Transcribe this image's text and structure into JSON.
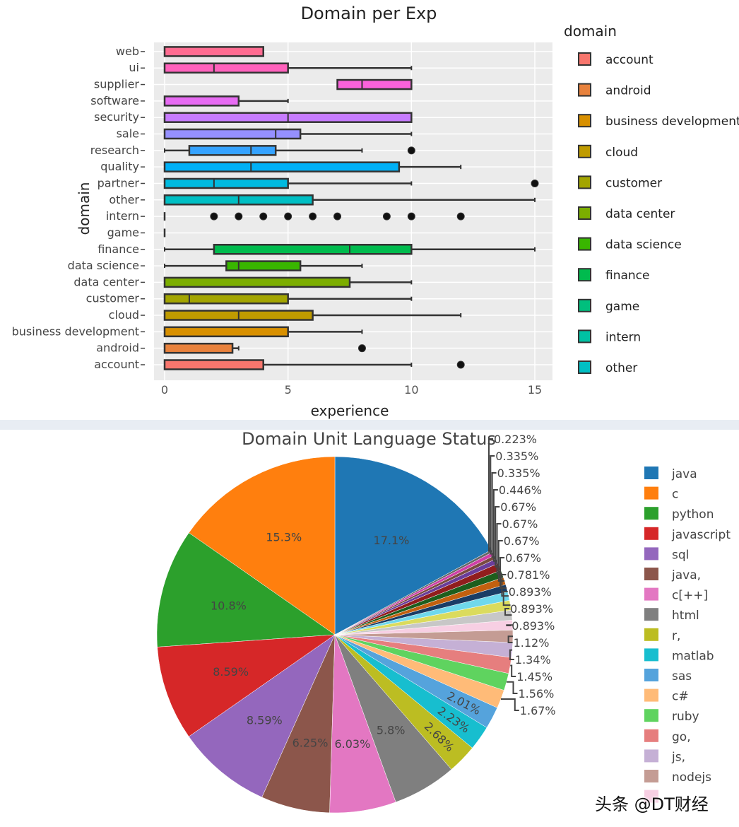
{
  "chart_data": [
    {
      "type": "box",
      "title": "Domain per Exp",
      "xlabel": "experience",
      "ylabel": "domain",
      "xlim": [
        -0.5,
        15.7
      ],
      "xticks": [
        0,
        5,
        10,
        15
      ],
      "grid": true,
      "legend_title": "domain",
      "legend_position": "right",
      "categories": [
        "account",
        "android",
        "business development",
        "cloud",
        "customer",
        "data center",
        "data science",
        "finance",
        "game",
        "intern",
        "other",
        "partner",
        "quality",
        "research",
        "sale",
        "security",
        "software",
        "supplier",
        "ui",
        "web"
      ],
      "series": [
        {
          "name": "account",
          "min": 0,
          "q1": 0,
          "median": 0,
          "q3": 4,
          "max": 10,
          "outliers": [
            12
          ],
          "color": "#F8766D"
        },
        {
          "name": "android",
          "min": 0,
          "q1": 0,
          "median": 0,
          "q3": 2.75,
          "max": 3,
          "outliers": [
            8
          ],
          "color": "#E8823D"
        },
        {
          "name": "business development",
          "min": 0,
          "q1": 0,
          "median": 0,
          "q3": 5,
          "max": 8,
          "outliers": [],
          "color": "#D89000"
        },
        {
          "name": "cloud",
          "min": 0,
          "q1": 0,
          "median": 3,
          "q3": 6,
          "max": 12,
          "outliers": [],
          "color": "#BF9B00"
        },
        {
          "name": "customer",
          "min": 0,
          "q1": 0,
          "median": 1,
          "q3": 5,
          "max": 10,
          "outliers": [],
          "color": "#A3A500"
        },
        {
          "name": "data center",
          "min": 0,
          "q1": 0,
          "median": 0,
          "q3": 7.5,
          "max": 10,
          "outliers": [],
          "color": "#7CAE00"
        },
        {
          "name": "data science",
          "min": 0,
          "q1": 2.5,
          "median": 3,
          "q3": 5.5,
          "max": 8,
          "outliers": [],
          "color": "#39B600"
        },
        {
          "name": "finance",
          "min": 0,
          "q1": 2,
          "median": 7.5,
          "q3": 10,
          "max": 15,
          "outliers": [],
          "color": "#00BB4E"
        },
        {
          "name": "game",
          "min": 0,
          "q1": 0,
          "median": 0,
          "q3": 0,
          "max": 0,
          "outliers": [],
          "color": "#00BF7D"
        },
        {
          "name": "intern",
          "min": 0,
          "q1": 0,
          "median": 0,
          "q3": 0,
          "max": 0,
          "outliers": [
            2,
            3,
            4,
            5,
            6,
            7,
            9,
            10,
            12
          ],
          "color": "#00C1A3"
        },
        {
          "name": "other",
          "min": 0,
          "q1": 0,
          "median": 3,
          "q3": 6,
          "max": 15,
          "outliers": [],
          "color": "#00BFC4"
        },
        {
          "name": "partner",
          "min": 0,
          "q1": 0,
          "median": 2,
          "q3": 5,
          "max": 10,
          "outliers": [
            15
          ],
          "color": "#00BAE0"
        },
        {
          "name": "quality",
          "min": 0,
          "q1": 0,
          "median": 3.5,
          "q3": 9.5,
          "max": 12,
          "outliers": [],
          "color": "#00B0F6"
        },
        {
          "name": "research",
          "min": 0,
          "q1": 1,
          "median": 3.5,
          "q3": 4.5,
          "max": 8,
          "outliers": [
            10
          ],
          "color": "#35A2FF"
        },
        {
          "name": "sale",
          "min": 0,
          "q1": 0,
          "median": 4.5,
          "q3": 5.5,
          "max": 10,
          "outliers": [],
          "color": "#9590FF"
        },
        {
          "name": "security",
          "min": 0,
          "q1": 0,
          "median": 5,
          "q3": 10,
          "max": 10,
          "outliers": [],
          "color": "#C77CFF"
        },
        {
          "name": "software",
          "min": 0,
          "q1": 0,
          "median": 0,
          "q3": 3,
          "max": 5,
          "outliers": [],
          "color": "#E76BF3"
        },
        {
          "name": "supplier",
          "min": 7,
          "q1": 7,
          "median": 8,
          "q3": 10,
          "max": 10,
          "outliers": [],
          "color": "#FA62DB"
        },
        {
          "name": "ui",
          "min": 0,
          "q1": 0,
          "median": 2,
          "q3": 5,
          "max": 10,
          "outliers": [],
          "color": "#FF62BC"
        },
        {
          "name": "web",
          "min": 0,
          "q1": 0,
          "median": 0,
          "q3": 4,
          "max": 4,
          "outliers": [],
          "color": "#FF6C91"
        }
      ],
      "legend_visible": [
        "account",
        "android",
        "business development",
        "cloud",
        "customer",
        "data center",
        "data science",
        "finance",
        "game",
        "intern",
        "other"
      ]
    },
    {
      "type": "pie",
      "title": "Domain Unit Language Status",
      "legend_position": "right",
      "slices": [
        {
          "label": "java",
          "value": 17.1,
          "text": "17.1%",
          "color": "#1f77b4"
        },
        {
          "label": "c",
          "value": 15.3,
          "text": "15.3%",
          "color": "#ff7f0e"
        },
        {
          "label": "python",
          "value": 10.8,
          "text": "10.8%",
          "color": "#2ca02c"
        },
        {
          "label": "javascript",
          "value": 8.59,
          "text": "8.59%",
          "color": "#d62728"
        },
        {
          "label": "sql",
          "value": 8.59,
          "text": "8.59%",
          "color": "#9467bd"
        },
        {
          "label": "java,",
          "value": 6.25,
          "text": "6.25%",
          "color": "#8c564b"
        },
        {
          "label": "c[++]",
          "value": 6.03,
          "text": "6.03%",
          "color": "#e377c2"
        },
        {
          "label": "html",
          "value": 5.8,
          "text": "5.8%",
          "color": "#7f7f7f"
        },
        {
          "label": " r,",
          "value": 2.68,
          "text": "2.68%",
          "color": "#bcbd22"
        },
        {
          "label": "matlab",
          "value": 2.23,
          "text": "2.23%",
          "color": "#17becf"
        },
        {
          "label": "sas",
          "value": 2.01,
          "text": "2.01%",
          "color": "#55a3dc"
        },
        {
          "label": "c#",
          "value": 1.67,
          "text": "1.67%",
          "color": "#ffbb78"
        },
        {
          "label": "ruby",
          "value": 1.56,
          "text": "1.56%",
          "color": "#5fd35f"
        },
        {
          "label": "go,",
          "value": 1.45,
          "text": "1.45%",
          "color": "#e67e7e"
        },
        {
          "label": "js,",
          "value": 1.34,
          "text": "1.34%",
          "color": "#c5b0d5"
        },
        {
          "label": "nodejs",
          "value": 1.12,
          "text": "1.12%",
          "color": "#c49c94"
        },
        {
          "label": "",
          "value": 0.893,
          "text": "0.893%",
          "color": "#f7cfe3"
        },
        {
          "label": "",
          "value": 0.893,
          "text": "0.893%",
          "color": "#c7c7c7"
        },
        {
          "label": "",
          "value": 0.893,
          "text": "0.893%",
          "color": "#dbdb5d"
        },
        {
          "label": "",
          "value": 0.781,
          "text": "0.781%",
          "color": "#6fd8ec"
        },
        {
          "label": "",
          "value": 0.67,
          "text": "0.67%",
          "color": "#1a3d66"
        },
        {
          "label": "",
          "value": 0.67,
          "text": "0.67%",
          "color": "#c2600f"
        },
        {
          "label": "",
          "value": 0.67,
          "text": "0.67%",
          "color": "#1d5e1d"
        },
        {
          "label": "",
          "value": 0.67,
          "text": "0.67%",
          "color": "#911d1d"
        },
        {
          "label": "",
          "value": 0.446,
          "text": "0.446%",
          "color": "#6a3d9a"
        },
        {
          "label": "",
          "value": 0.335,
          "text": "0.335%",
          "color": "#7a4a40"
        },
        {
          "label": "",
          "value": 0.335,
          "text": "0.335%",
          "color": "#d040a8"
        },
        {
          "label": "",
          "value": 0.223,
          "text": "0.223%",
          "color": "#666666"
        }
      ],
      "legend_visible_count": 17
    }
  ],
  "watermark": "头条 @DT财经"
}
